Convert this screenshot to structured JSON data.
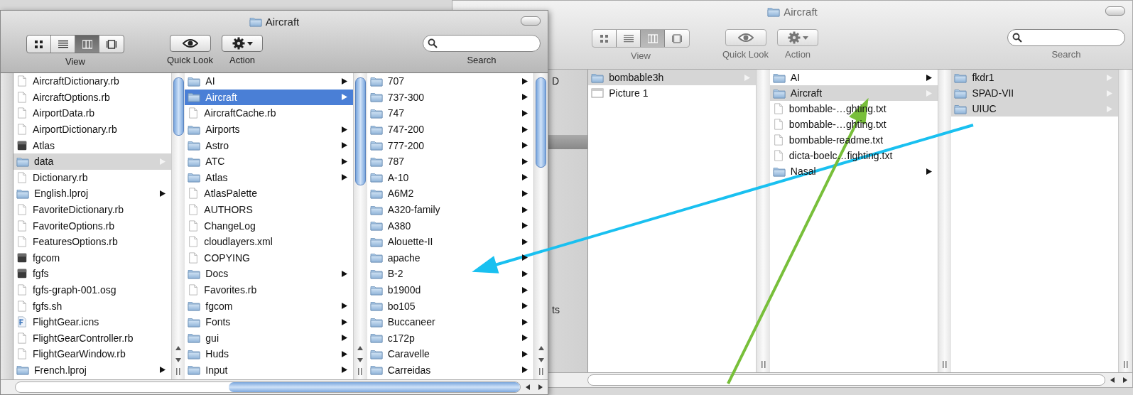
{
  "windows": [
    {
      "title": "Aircraft",
      "active": true,
      "toolbar": {
        "view_buttons": [
          {
            "selected": false
          },
          {
            "selected": false
          },
          {
            "selected": true
          },
          {
            "selected": false
          }
        ],
        "view_label": "View",
        "quick_look_label": "Quick Look",
        "action_label": "Action",
        "search_label": "Search"
      },
      "columns": [
        {
          "items": [
            {
              "name": "AircraftDictionary.rb",
              "kind": "file",
              "expandable": false,
              "selected": false
            },
            {
              "name": "AircraftOptions.rb",
              "kind": "file",
              "expandable": false,
              "selected": false
            },
            {
              "name": "AirportData.rb",
              "kind": "file",
              "expandable": false,
              "selected": false
            },
            {
              "name": "AirportDictionary.rb",
              "kind": "file",
              "expandable": false,
              "selected": false
            },
            {
              "name": "Atlas",
              "kind": "app",
              "expandable": false,
              "selected": false
            },
            {
              "name": "data",
              "kind": "folder",
              "expandable": true,
              "selected": true
            },
            {
              "name": "Dictionary.rb",
              "kind": "file",
              "expandable": false,
              "selected": false
            },
            {
              "name": "English.lproj",
              "kind": "folder",
              "expandable": true,
              "selected": false
            },
            {
              "name": "FavoriteDictionary.rb",
              "kind": "file",
              "expandable": false,
              "selected": false
            },
            {
              "name": "FavoriteOptions.rb",
              "kind": "file",
              "expandable": false,
              "selected": false
            },
            {
              "name": "FeaturesOptions.rb",
              "kind": "file",
              "expandable": false,
              "selected": false
            },
            {
              "name": "fgcom",
              "kind": "app",
              "expandable": false,
              "selected": false
            },
            {
              "name": "fgfs",
              "kind": "app",
              "expandable": false,
              "selected": false
            },
            {
              "name": "fgfs-graph-001.osg",
              "kind": "file",
              "expandable": false,
              "selected": false
            },
            {
              "name": "fgfs.sh",
              "kind": "file",
              "expandable": false,
              "selected": false
            },
            {
              "name": "FlightGear.icns",
              "kind": "icns",
              "expandable": false,
              "selected": false
            },
            {
              "name": "FlightGearController.rb",
              "kind": "file",
              "expandable": false,
              "selected": false
            },
            {
              "name": "FlightGearWindow.rb",
              "kind": "file",
              "expandable": false,
              "selected": false
            },
            {
              "name": "French.lproj",
              "kind": "folder",
              "expandable": true,
              "selected": false
            }
          ]
        },
        {
          "items": [
            {
              "name": "AI",
              "kind": "folder",
              "expandable": true,
              "selected": false
            },
            {
              "name": "Aircraft",
              "kind": "folder",
              "expandable": true,
              "selected": true
            },
            {
              "name": "AircraftCache.rb",
              "kind": "file",
              "expandable": false,
              "selected": false
            },
            {
              "name": "Airports",
              "kind": "folder",
              "expandable": true,
              "selected": false
            },
            {
              "name": "Astro",
              "kind": "folder",
              "expandable": true,
              "selected": false
            },
            {
              "name": "ATC",
              "kind": "folder",
              "expandable": true,
              "selected": false
            },
            {
              "name": "Atlas",
              "kind": "folder",
              "expandable": true,
              "selected": false
            },
            {
              "name": "AtlasPalette",
              "kind": "file",
              "expandable": false,
              "selected": false
            },
            {
              "name": "AUTHORS",
              "kind": "file",
              "expandable": false,
              "selected": false
            },
            {
              "name": "ChangeLog",
              "kind": "file",
              "expandable": false,
              "selected": false
            },
            {
              "name": "cloudlayers.xml",
              "kind": "file",
              "expandable": false,
              "selected": false
            },
            {
              "name": "COPYING",
              "kind": "file",
              "expandable": false,
              "selected": false
            },
            {
              "name": "Docs",
              "kind": "folder",
              "expandable": true,
              "selected": false
            },
            {
              "name": "Favorites.rb",
              "kind": "file",
              "expandable": false,
              "selected": false
            },
            {
              "name": "fgcom",
              "kind": "folder",
              "expandable": true,
              "selected": false
            },
            {
              "name": "Fonts",
              "kind": "folder",
              "expandable": true,
              "selected": false
            },
            {
              "name": "gui",
              "kind": "folder",
              "expandable": true,
              "selected": false
            },
            {
              "name": "Huds",
              "kind": "folder",
              "expandable": true,
              "selected": false
            },
            {
              "name": "Input",
              "kind": "folder",
              "expandable": true,
              "selected": false
            }
          ]
        },
        {
          "items": [
            {
              "name": "707",
              "kind": "folder",
              "expandable": true,
              "selected": false
            },
            {
              "name": "737-300",
              "kind": "folder",
              "expandable": true,
              "selected": false
            },
            {
              "name": "747",
              "kind": "folder",
              "expandable": true,
              "selected": false
            },
            {
              "name": "747-200",
              "kind": "folder",
              "expandable": true,
              "selected": false
            },
            {
              "name": "777-200",
              "kind": "folder",
              "expandable": true,
              "selected": false
            },
            {
              "name": "787",
              "kind": "folder",
              "expandable": true,
              "selected": false
            },
            {
              "name": "A-10",
              "kind": "folder",
              "expandable": true,
              "selected": false
            },
            {
              "name": "A6M2",
              "kind": "folder",
              "expandable": true,
              "selected": false
            },
            {
              "name": "A320-family",
              "kind": "folder",
              "expandable": true,
              "selected": false
            },
            {
              "name": "A380",
              "kind": "folder",
              "expandable": true,
              "selected": false
            },
            {
              "name": "Alouette-II",
              "kind": "folder",
              "expandable": true,
              "selected": false
            },
            {
              "name": "apache",
              "kind": "folder",
              "expandable": true,
              "selected": false
            },
            {
              "name": "B-2",
              "kind": "folder",
              "expandable": true,
              "selected": false
            },
            {
              "name": "b1900d",
              "kind": "folder",
              "expandable": true,
              "selected": false
            },
            {
              "name": "bo105",
              "kind": "folder",
              "expandable": true,
              "selected": false
            },
            {
              "name": "Buccaneer",
              "kind": "folder",
              "expandable": true,
              "selected": false
            },
            {
              "name": "c172p",
              "kind": "folder",
              "expandable": true,
              "selected": false
            },
            {
              "name": "Caravelle",
              "kind": "folder",
              "expandable": true,
              "selected": false
            },
            {
              "name": "Carreidas",
              "kind": "folder",
              "expandable": true,
              "selected": false
            }
          ]
        }
      ]
    },
    {
      "title": "Aircraft",
      "active": false,
      "toolbar": {
        "view_buttons": [
          {
            "selected": false
          },
          {
            "selected": false
          },
          {
            "selected": true
          },
          {
            "selected": false
          }
        ],
        "view_label": "View",
        "quick_look_label": "Quick Look",
        "action_label": "Action",
        "search_label": "Search"
      },
      "sidebar": [
        {
          "text": "D"
        },
        {
          "text": "ts"
        }
      ],
      "columns": [
        {
          "items": [
            {
              "name": "bombable3h",
              "kind": "folder",
              "expandable": true,
              "selected": true
            },
            {
              "name": "Picture 1",
              "kind": "picture",
              "expandable": false,
              "selected": false
            }
          ]
        },
        {
          "items": [
            {
              "name": "AI",
              "kind": "folder",
              "expandable": true,
              "selected": false
            },
            {
              "name": "Aircraft",
              "kind": "folder",
              "expandable": true,
              "selected": true
            },
            {
              "name": "bombable-…ghting.txt",
              "kind": "file",
              "expandable": false,
              "selected": false
            },
            {
              "name": "bombable-…ghting.txt",
              "kind": "file",
              "expandable": false,
              "selected": false
            },
            {
              "name": "bombable-readme.txt",
              "kind": "file",
              "expandable": false,
              "selected": false
            },
            {
              "name": "dicta-boelc…fighting.txt",
              "kind": "file",
              "expandable": false,
              "selected": false
            },
            {
              "name": "Nasal",
              "kind": "folder",
              "expandable": true,
              "selected": false
            }
          ]
        },
        {
          "items": [
            {
              "name": "fkdr1",
              "kind": "folder",
              "expandable": true,
              "selected": true
            },
            {
              "name": "SPAD-VII",
              "kind": "folder",
              "expandable": true,
              "selected": true
            },
            {
              "name": "UIUC",
              "kind": "folder",
              "expandable": true,
              "selected": true
            }
          ]
        }
      ]
    }
  ]
}
